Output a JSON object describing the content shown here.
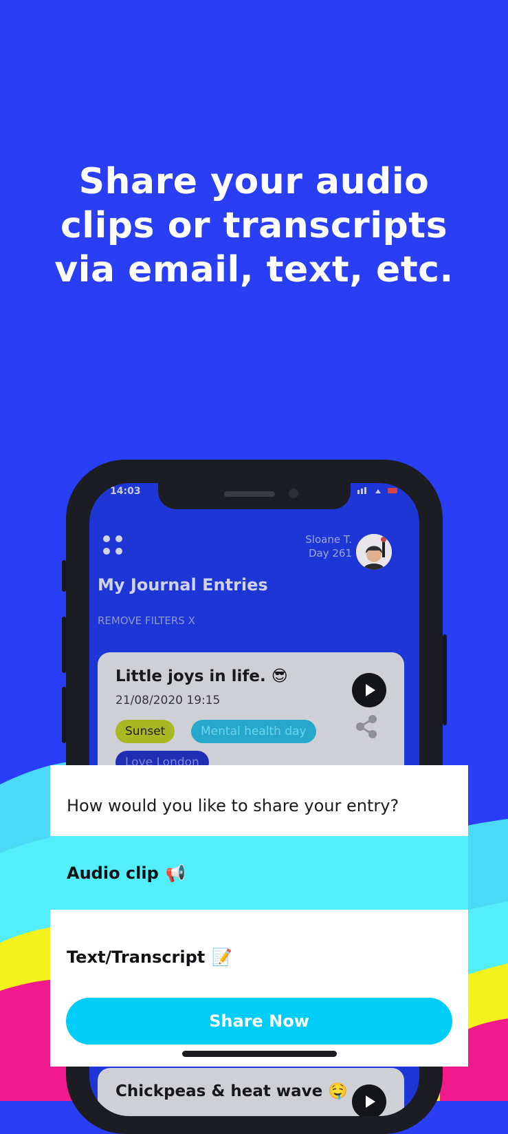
{
  "promo": {
    "headline_line1": "Share your audio",
    "headline_line2": "clips or transcripts",
    "headline_line3": "via email, text, etc."
  },
  "phone_screen": {
    "status_time": "14:03",
    "user_name": "Sloane T.",
    "user_day": "Day 261",
    "list_title": "My Journal Entries",
    "remove_filters": "REMOVE FILTERS X",
    "entries": [
      {
        "title": "Little joys in life. 😎",
        "date": "21/08/2020 19:15",
        "tags": [
          "Sunset",
          "Mental health day",
          "Love London"
        ]
      },
      {
        "title": "Chickpeas & heat wave 🤤"
      }
    ]
  },
  "share_sheet": {
    "question": "How would you like to share your entry?",
    "option_audio": "Audio clip",
    "option_audio_emoji": "📢",
    "option_text": "Text/Transcript",
    "option_text_emoji": "📝",
    "share_button": "Share Now"
  },
  "colors": {
    "background": "#2a3ff5",
    "selected_option": "#52eef9",
    "share_button": "#00cdf7"
  }
}
